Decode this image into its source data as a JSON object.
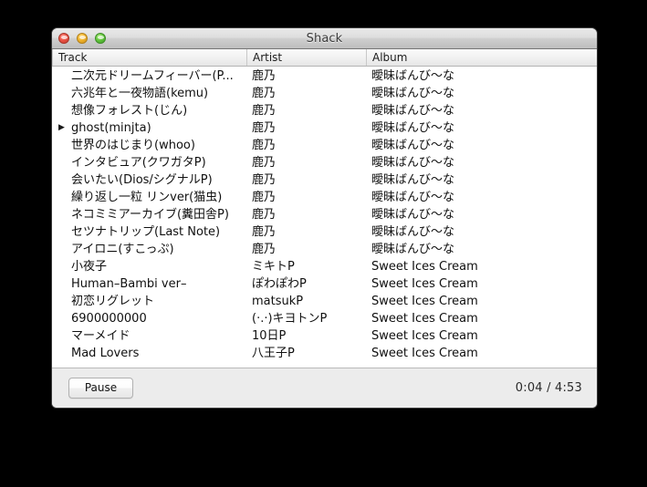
{
  "window": {
    "title": "Shack",
    "controls": [
      {
        "name": "close-button",
        "label": ""
      },
      {
        "name": "minimize-button",
        "label": ""
      },
      {
        "name": "zoom-button",
        "label": ""
      }
    ]
  },
  "columns": {
    "track": "Track",
    "artist": "Artist",
    "album": "Album"
  },
  "now_playing_index": 3,
  "play_indicator_glyph": "▶",
  "tracks": [
    {
      "indicator": "",
      "track": "二次元ドリームフィーバー(P...",
      "artist": "鹿乃",
      "album": "曖昧ばんび〜な"
    },
    {
      "indicator": "",
      "track": "六兆年と一夜物語(kemu)",
      "artist": "鹿乃",
      "album": "曖昧ばんび〜な"
    },
    {
      "indicator": "",
      "track": "想像フォレスト(じん)",
      "artist": "鹿乃",
      "album": "曖昧ばんび〜な"
    },
    {
      "indicator": "▶",
      "track": "ghost(minjta)",
      "artist": "鹿乃",
      "album": "曖昧ばんび〜な"
    },
    {
      "indicator": "",
      "track": "世界のはじまり(whoo)",
      "artist": "鹿乃",
      "album": "曖昧ばんび〜な"
    },
    {
      "indicator": "",
      "track": "インタビュア(クワガタP)",
      "artist": "鹿乃",
      "album": "曖昧ばんび〜な"
    },
    {
      "indicator": "",
      "track": "会いたい(Dios/シグナルP)",
      "artist": "鹿乃",
      "album": "曖昧ばんび〜な"
    },
    {
      "indicator": "",
      "track": "繰り返し一粒 リンver(猫虫)",
      "artist": "鹿乃",
      "album": "曖昧ばんび〜な"
    },
    {
      "indicator": "",
      "track": "ネコミミアーカイブ(糞田舎P)",
      "artist": "鹿乃",
      "album": "曖昧ばんび〜な"
    },
    {
      "indicator": "",
      "track": "セツナトリップ(Last Note)",
      "artist": "鹿乃",
      "album": "曖昧ばんび〜な"
    },
    {
      "indicator": "",
      "track": "アイロニ(すこっぷ)",
      "artist": "鹿乃",
      "album": "曖昧ばんび〜な"
    },
    {
      "indicator": "",
      "track": "小夜子",
      "artist": "ミキトP",
      "album": "Sweet Ices Cream"
    },
    {
      "indicator": "",
      "track": "Human–Bambi ver–",
      "artist": "ぽわぽわP",
      "album": "Sweet Ices Cream"
    },
    {
      "indicator": "",
      "track": "初恋リグレット",
      "artist": "matsukP",
      "album": "Sweet Ices Cream"
    },
    {
      "indicator": "",
      "track": "6900000000",
      "artist": "(·.·)キヨトンP",
      "album": "Sweet Ices Cream"
    },
    {
      "indicator": "",
      "track": "マーメイド",
      "artist": "10日P",
      "album": "Sweet Ices Cream"
    },
    {
      "indicator": "",
      "track": "Mad Lovers",
      "artist": "八王子P",
      "album": "Sweet Ices Cream"
    }
  ],
  "controls": {
    "pause_label": "Pause",
    "elapsed_time": "0:04",
    "total_time": "4:53",
    "time_display": "0:04 / 4:53"
  },
  "colors": {
    "window_chrome": "#ececec",
    "list_background": "#ffffff",
    "text": "#101010",
    "desktop": "#000000"
  }
}
